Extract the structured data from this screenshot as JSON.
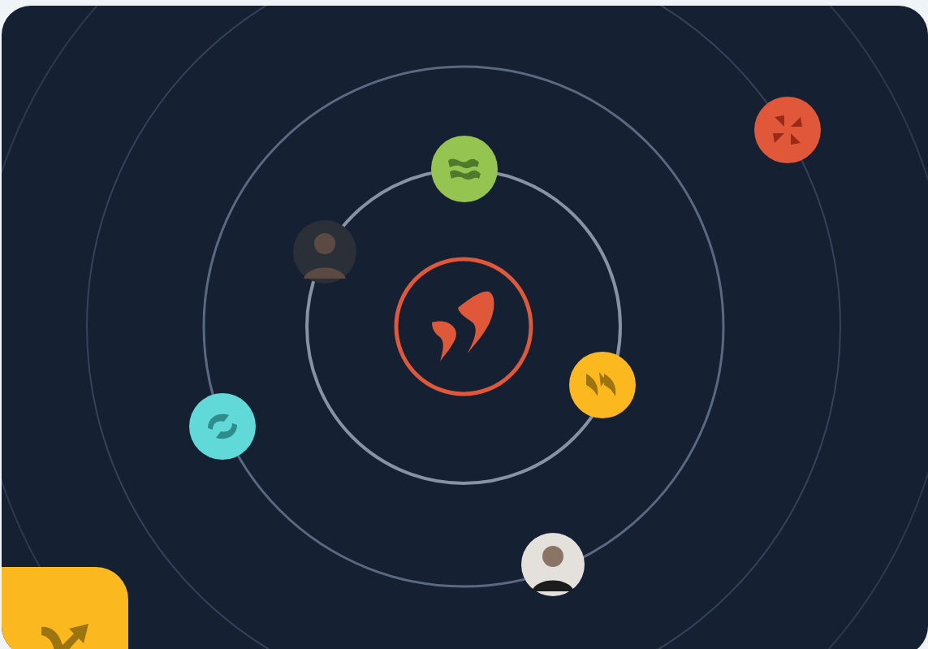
{
  "orbit_badges": [
    {
      "kind": "wave",
      "color": "#95c550"
    },
    {
      "kind": "pinwheel",
      "color": "#e0573a"
    },
    {
      "kind": "quotes",
      "color": "#fcb91f"
    },
    {
      "kind": "swirl",
      "color": "#62d9d9"
    }
  ]
}
